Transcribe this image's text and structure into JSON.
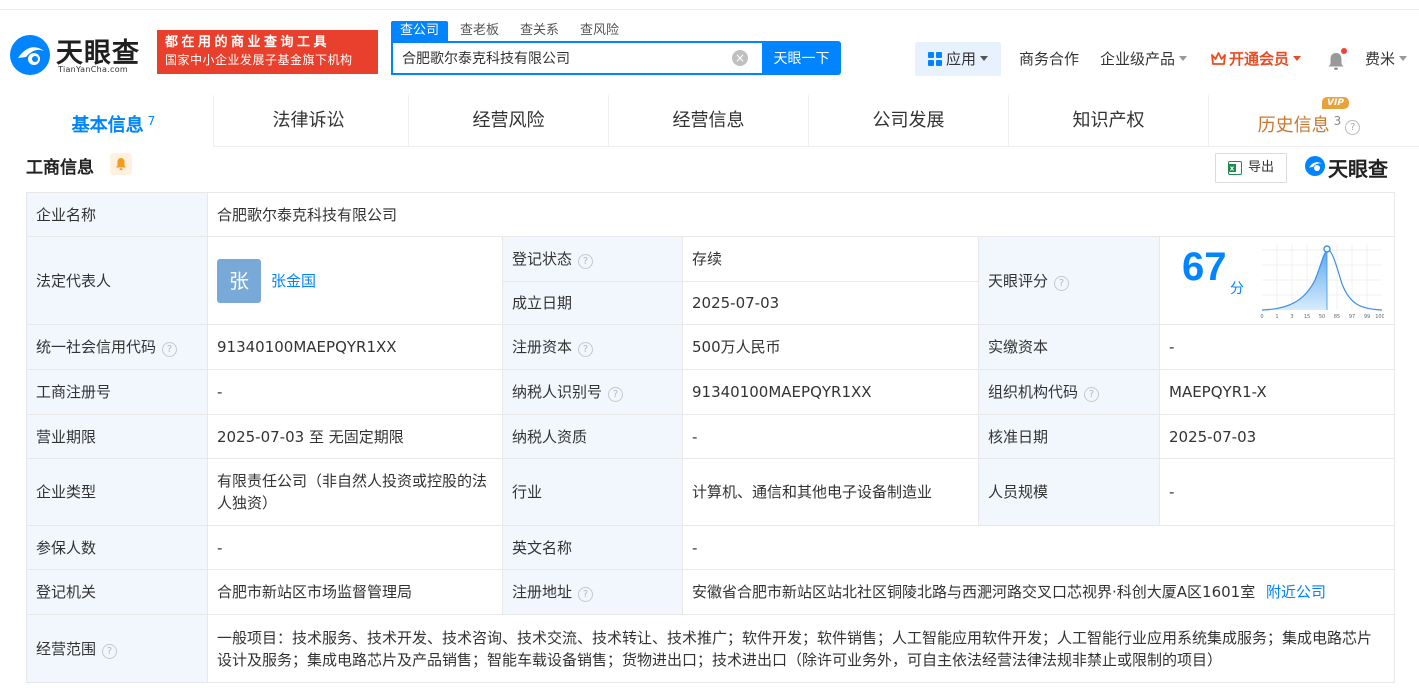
{
  "header": {
    "logo_text": "天眼查",
    "logo_sub": "TianYanCha.com",
    "slogan_line1": "都在用的商业查询工具",
    "slogan_line2": "国家中小企业发展子基金旗下机构",
    "search_tabs": [
      "查公司",
      "查老板",
      "查关系",
      "查风险"
    ],
    "search_value": "合肥歌尔泰克科技有限公司",
    "search_button": "天眼一下",
    "clear_glyph": "×",
    "nav": {
      "apps": "应用",
      "business": "商务合作",
      "enterprise": "企业级产品",
      "vip": "开通会员",
      "user": "费米"
    }
  },
  "tabs": [
    {
      "label": "基本信息",
      "count": "7"
    },
    {
      "label": "法律诉讼"
    },
    {
      "label": "经营风险"
    },
    {
      "label": "经营信息"
    },
    {
      "label": "公司发展"
    },
    {
      "label": "知识产权"
    },
    {
      "label": "历史信息",
      "count": "3",
      "badge": "VIP"
    }
  ],
  "section": {
    "title": "工商信息",
    "export": "导出",
    "brand": "天眼查"
  },
  "info": {
    "company_name_k": "企业名称",
    "company_name_v": "合肥歌尔泰克科技有限公司",
    "legal_rep_k": "法定代表人",
    "legal_rep_avatar": "张",
    "legal_rep_v": "张金国",
    "reg_status_k": "登记状态",
    "reg_status_v": "存续",
    "found_date_k": "成立日期",
    "found_date_v": "2025-07-03",
    "score_k": "天眼评分",
    "score_v": "67",
    "score_unit": "分",
    "score_ticks": [
      "0",
      "1",
      "3",
      "15",
      "50",
      "85",
      "97",
      "99",
      "100"
    ],
    "credit_code_k": "统一社会信用代码",
    "credit_code_v": "91340100MAEPQYR1XX",
    "reg_capital_k": "注册资本",
    "reg_capital_v": "500万人民币",
    "paid_capital_k": "实缴资本",
    "paid_capital_v": "-",
    "biz_reg_no_k": "工商注册号",
    "biz_reg_no_v": "-",
    "taxpayer_id_k": "纳税人识别号",
    "taxpayer_id_v": "91340100MAEPQYR1XX",
    "org_code_k": "组织机构代码",
    "org_code_v": "MAEPQYR1-X",
    "term_k": "营业期限",
    "term_v": "2025-07-03 至 无固定期限",
    "taxpayer_qual_k": "纳税人资质",
    "taxpayer_qual_v": "-",
    "approve_date_k": "核准日期",
    "approve_date_v": "2025-07-03",
    "type_k": "企业类型",
    "type_v": "有限责任公司（非自然人投资或控股的法人独资）",
    "industry_k": "行业",
    "industry_v": "计算机、通信和其他电子设备制造业",
    "staff_k": "人员规模",
    "staff_v": "-",
    "insured_k": "参保人数",
    "insured_v": "-",
    "en_name_k": "英文名称",
    "en_name_v": "-",
    "authority_k": "登记机关",
    "authority_v": "合肥市新站区市场监督管理局",
    "address_k": "注册地址",
    "address_v": "安徽省合肥市新站区站北社区铜陵北路与西淝河路交叉口芯视界·科创大厦A区1601室",
    "nearby": "附近公司",
    "scope_k": "经营范围",
    "scope_v": "一般项目：技术服务、技术开发、技术咨询、技术交流、技术转让、技术推广；软件开发；软件销售；人工智能应用软件开发；人工智能行业应用系统集成服务；集成电路芯片设计及服务；集成电路芯片及产品销售；智能车载设备销售；货物进出口；技术进出口（除许可业务外，可自主依法经营法律法规非禁止或限制的项目）"
  },
  "colors": {
    "accent": "#0084ff",
    "slogan_bg": "#e8402c",
    "status_green": "#27a35a",
    "vip_orange": "#ea4d24"
  }
}
